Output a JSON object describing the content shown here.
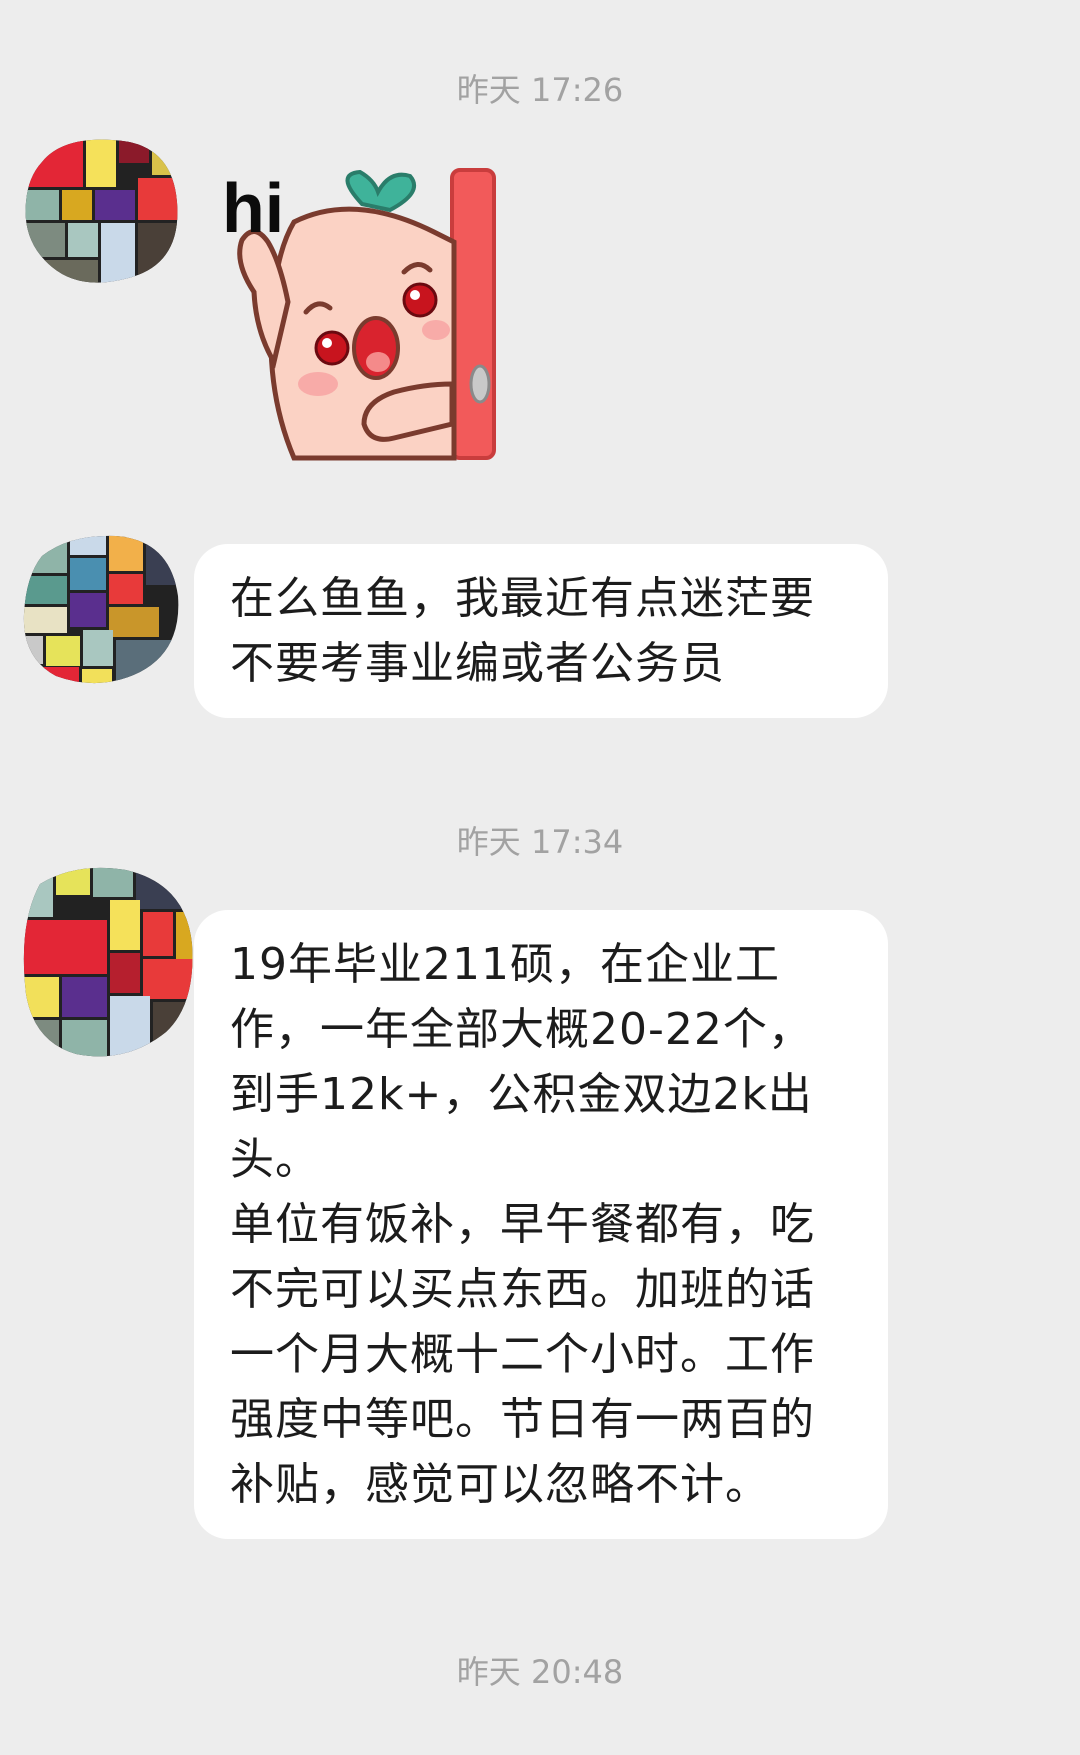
{
  "chat": {
    "messages": [
      {
        "timestamp": "昨天 17:26",
        "sticker": {
          "caption": "hi",
          "icon": "waving-peach-character-sticker"
        }
      },
      {
        "text": "在么鱼鱼，我最近有点迷茫要\n不要考事业编或者公务员"
      },
      {
        "timestamp": "昨天 17:34",
        "text": "19年毕业211硕，在企业工\n作，一年全部大概20-22个，\n到手12k+，公积金双边2k出\n头。\n单位有饭补，早午餐都有，吃\n不完可以买点东西。加班的话\n一个月大概十二个小时。工作\n强度中等吧。节日有一两百的\n补贴，感觉可以忽略不计。"
      },
      {
        "timestamp": "昨天 20:48"
      }
    ]
  },
  "colors": {
    "background": "#ededed",
    "bubble": "#ffffff",
    "timestamp_text": "#a2a2a2",
    "message_text": "#1c1c1c"
  }
}
